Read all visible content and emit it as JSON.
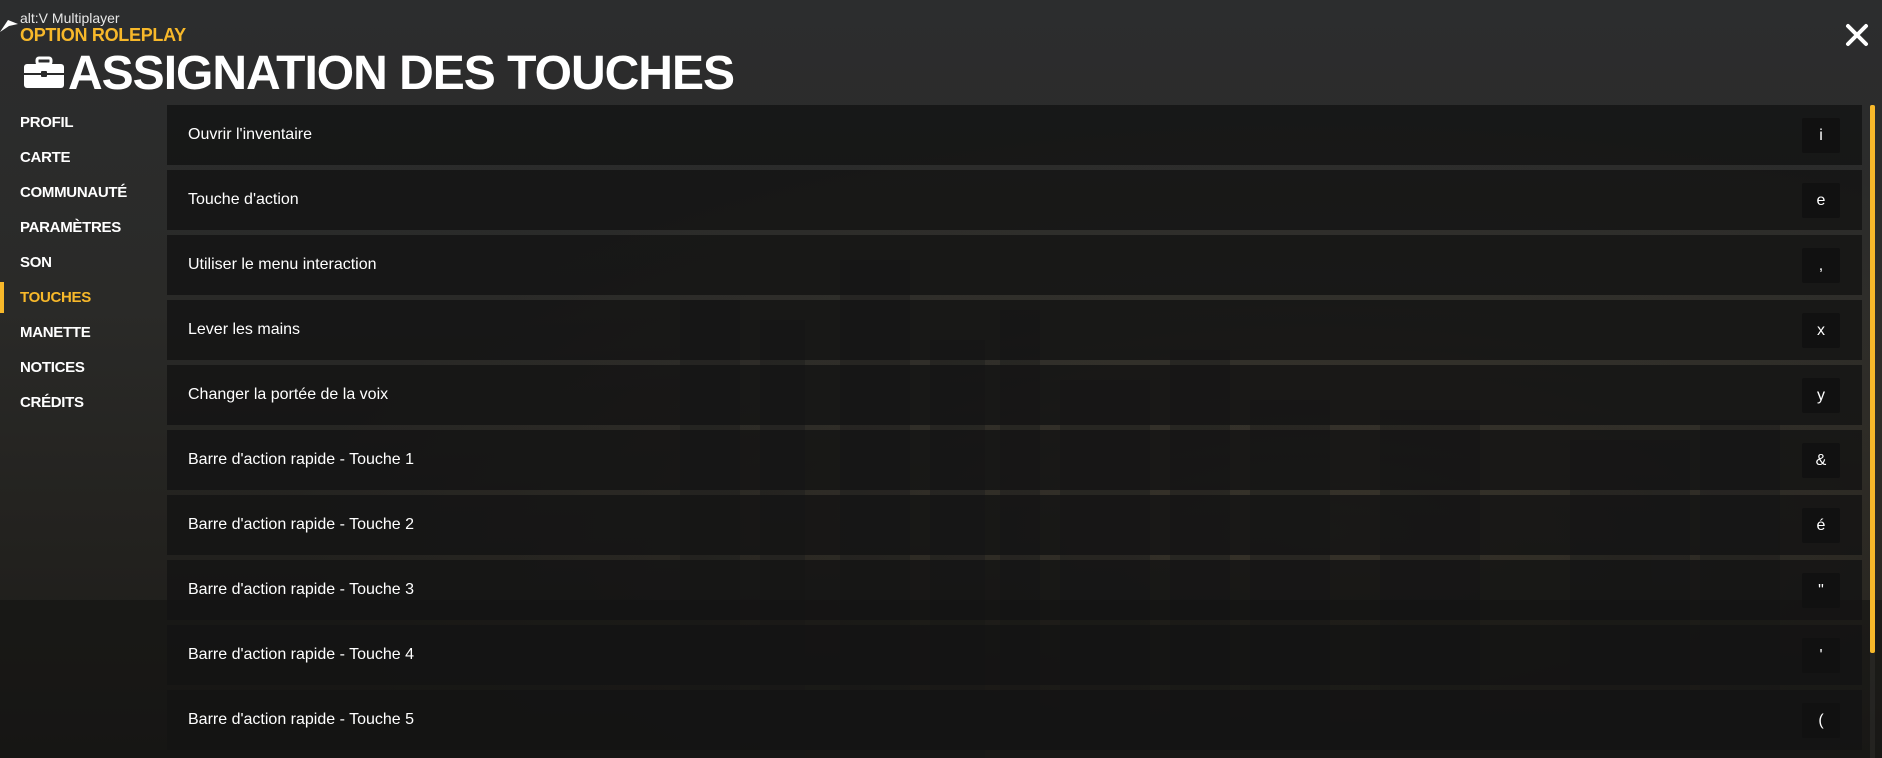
{
  "brand": {
    "subtitle": "alt:V Multiplayer",
    "title": "OPTION ROLEPLAY"
  },
  "header": {
    "title": "ASSIGNATION DES TOUCHES",
    "icon": "toolbox-icon"
  },
  "close_icon": "close-icon",
  "sidebar": {
    "items": [
      {
        "label": "PROFIL",
        "active": false
      },
      {
        "label": "CARTE",
        "active": false
      },
      {
        "label": "COMMUNAUTÉ",
        "active": false
      },
      {
        "label": "PARAMÈTRES",
        "active": false
      },
      {
        "label": "SON",
        "active": false
      },
      {
        "label": "TOUCHES",
        "active": true
      },
      {
        "label": "MANETTE",
        "active": false
      },
      {
        "label": "NOTICES",
        "active": false
      },
      {
        "label": "CRÉDITS",
        "active": false
      }
    ]
  },
  "keybinds": [
    {
      "action": "Ouvrir l'inventaire",
      "key": "i"
    },
    {
      "action": "Touche d'action",
      "key": "e"
    },
    {
      "action": "Utiliser le menu interaction",
      "key": ","
    },
    {
      "action": "Lever les mains",
      "key": "x"
    },
    {
      "action": "Changer la portée de la voix",
      "key": "y"
    },
    {
      "action": "Barre d'action rapide - Touche 1",
      "key": "&"
    },
    {
      "action": "Barre d'action rapide - Touche 2",
      "key": "é"
    },
    {
      "action": "Barre d'action rapide - Touche 3",
      "key": "\""
    },
    {
      "action": "Barre d'action rapide - Touche 4",
      "key": "'"
    },
    {
      "action": "Barre d'action rapide - Touche 5",
      "key": "("
    }
  ],
  "colors": {
    "accent": "#f7b82a",
    "row_background": "#141414",
    "key_background": "#111111"
  }
}
